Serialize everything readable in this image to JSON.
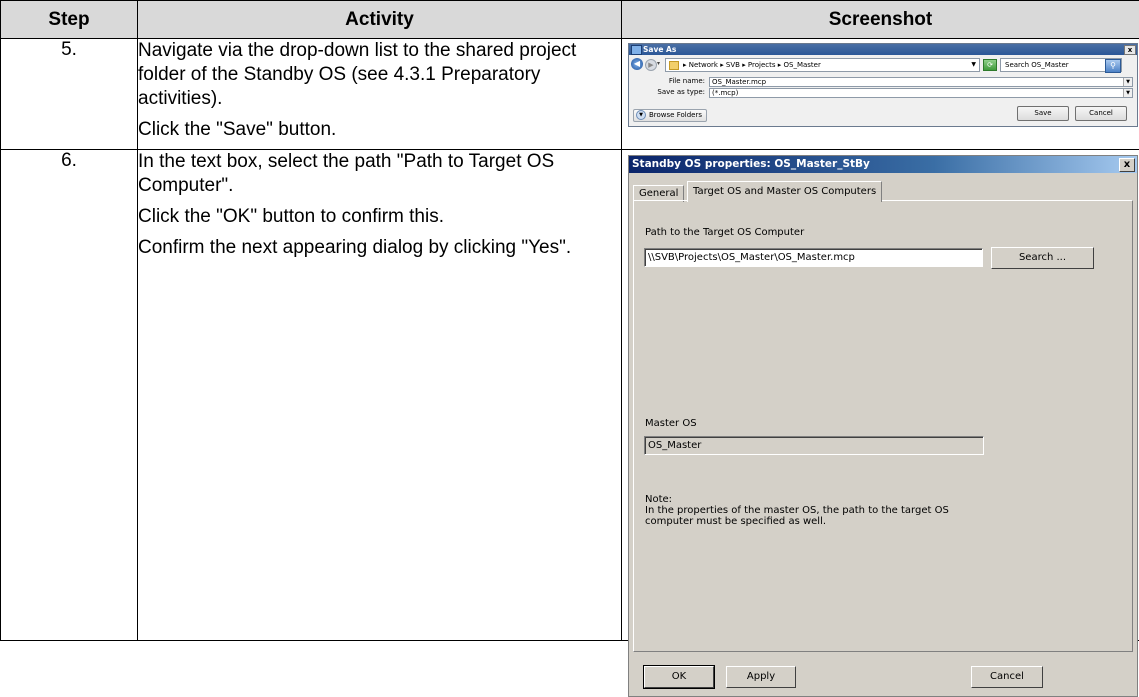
{
  "table": {
    "headers": [
      "Step",
      "Activity",
      "Screenshot"
    ],
    "rows": [
      {
        "step": "5.",
        "activity": [
          "Navigate via the drop-down list to the shared project folder of the Standby OS (see 4.3.1 Preparatory activities).",
          "Click the \"Save\" button."
        ]
      },
      {
        "step": "6.",
        "activity": [
          "In the text box, select the path \"Path to Target OS Computer\".",
          "Click the \"OK\" button to confirm this.",
          "Confirm the next appearing dialog by clicking \"Yes\"."
        ]
      }
    ]
  },
  "save_as": {
    "title": "Save As",
    "close": "x",
    "breadcrumb": "▸ Network ▸ SVB ▸ Projects ▸ OS_Master",
    "search_placeholder": "Search OS_Master",
    "file_name_label": "File name:",
    "file_name_value": "OS_Master.mcp",
    "save_as_type_label": "Save as type:",
    "save_as_type_value": "(*.mcp)",
    "browse_folders": "Browse Folders",
    "save_button": "Save",
    "cancel_button": "Cancel"
  },
  "standby_props": {
    "title": "Standby OS properties: OS_Master_StBy",
    "close": "x",
    "tabs": [
      "General",
      "Target OS and Master OS Computers"
    ],
    "active_tab": 1,
    "path_label": "Path to the Target OS Computer",
    "path_value": "\\\\SVB\\Projects\\OS_Master\\OS_Master.mcp",
    "search_button": "Search ...",
    "master_os_label": "Master OS",
    "master_os_value": "OS_Master",
    "note_label": "Note:",
    "note_line1": "In the properties of the master OS, the path to the target OS",
    "note_line2": "computer must be specified as well.",
    "ok_button": "OK",
    "apply_button": "Apply",
    "cancel_button": "Cancel"
  },
  "colors": {
    "header_bg": "#d9d9d9",
    "dialog_bg": "#d4d0c8",
    "titlebar_start": "#0a246a",
    "titlebar_end": "#a6caf0"
  }
}
